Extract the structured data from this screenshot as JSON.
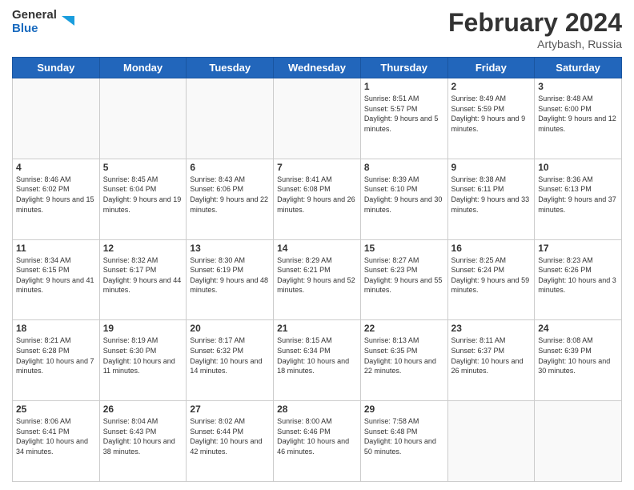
{
  "header": {
    "logo_line1": "General",
    "logo_line2": "Blue",
    "month_title": "February 2024",
    "subtitle": "Artybash, Russia"
  },
  "weekdays": [
    "Sunday",
    "Monday",
    "Tuesday",
    "Wednesday",
    "Thursday",
    "Friday",
    "Saturday"
  ],
  "weeks": [
    [
      {
        "day": "",
        "info": ""
      },
      {
        "day": "",
        "info": ""
      },
      {
        "day": "",
        "info": ""
      },
      {
        "day": "",
        "info": ""
      },
      {
        "day": "1",
        "info": "Sunrise: 8:51 AM\nSunset: 5:57 PM\nDaylight: 9 hours and 5 minutes."
      },
      {
        "day": "2",
        "info": "Sunrise: 8:49 AM\nSunset: 5:59 PM\nDaylight: 9 hours and 9 minutes."
      },
      {
        "day": "3",
        "info": "Sunrise: 8:48 AM\nSunset: 6:00 PM\nDaylight: 9 hours and 12 minutes."
      }
    ],
    [
      {
        "day": "4",
        "info": "Sunrise: 8:46 AM\nSunset: 6:02 PM\nDaylight: 9 hours and 15 minutes."
      },
      {
        "day": "5",
        "info": "Sunrise: 8:45 AM\nSunset: 6:04 PM\nDaylight: 9 hours and 19 minutes."
      },
      {
        "day": "6",
        "info": "Sunrise: 8:43 AM\nSunset: 6:06 PM\nDaylight: 9 hours and 22 minutes."
      },
      {
        "day": "7",
        "info": "Sunrise: 8:41 AM\nSunset: 6:08 PM\nDaylight: 9 hours and 26 minutes."
      },
      {
        "day": "8",
        "info": "Sunrise: 8:39 AM\nSunset: 6:10 PM\nDaylight: 9 hours and 30 minutes."
      },
      {
        "day": "9",
        "info": "Sunrise: 8:38 AM\nSunset: 6:11 PM\nDaylight: 9 hours and 33 minutes."
      },
      {
        "day": "10",
        "info": "Sunrise: 8:36 AM\nSunset: 6:13 PM\nDaylight: 9 hours and 37 minutes."
      }
    ],
    [
      {
        "day": "11",
        "info": "Sunrise: 8:34 AM\nSunset: 6:15 PM\nDaylight: 9 hours and 41 minutes."
      },
      {
        "day": "12",
        "info": "Sunrise: 8:32 AM\nSunset: 6:17 PM\nDaylight: 9 hours and 44 minutes."
      },
      {
        "day": "13",
        "info": "Sunrise: 8:30 AM\nSunset: 6:19 PM\nDaylight: 9 hours and 48 minutes."
      },
      {
        "day": "14",
        "info": "Sunrise: 8:29 AM\nSunset: 6:21 PM\nDaylight: 9 hours and 52 minutes."
      },
      {
        "day": "15",
        "info": "Sunrise: 8:27 AM\nSunset: 6:23 PM\nDaylight: 9 hours and 55 minutes."
      },
      {
        "day": "16",
        "info": "Sunrise: 8:25 AM\nSunset: 6:24 PM\nDaylight: 9 hours and 59 minutes."
      },
      {
        "day": "17",
        "info": "Sunrise: 8:23 AM\nSunset: 6:26 PM\nDaylight: 10 hours and 3 minutes."
      }
    ],
    [
      {
        "day": "18",
        "info": "Sunrise: 8:21 AM\nSunset: 6:28 PM\nDaylight: 10 hours and 7 minutes."
      },
      {
        "day": "19",
        "info": "Sunrise: 8:19 AM\nSunset: 6:30 PM\nDaylight: 10 hours and 11 minutes."
      },
      {
        "day": "20",
        "info": "Sunrise: 8:17 AM\nSunset: 6:32 PM\nDaylight: 10 hours and 14 minutes."
      },
      {
        "day": "21",
        "info": "Sunrise: 8:15 AM\nSunset: 6:34 PM\nDaylight: 10 hours and 18 minutes."
      },
      {
        "day": "22",
        "info": "Sunrise: 8:13 AM\nSunset: 6:35 PM\nDaylight: 10 hours and 22 minutes."
      },
      {
        "day": "23",
        "info": "Sunrise: 8:11 AM\nSunset: 6:37 PM\nDaylight: 10 hours and 26 minutes."
      },
      {
        "day": "24",
        "info": "Sunrise: 8:08 AM\nSunset: 6:39 PM\nDaylight: 10 hours and 30 minutes."
      }
    ],
    [
      {
        "day": "25",
        "info": "Sunrise: 8:06 AM\nSunset: 6:41 PM\nDaylight: 10 hours and 34 minutes."
      },
      {
        "day": "26",
        "info": "Sunrise: 8:04 AM\nSunset: 6:43 PM\nDaylight: 10 hours and 38 minutes."
      },
      {
        "day": "27",
        "info": "Sunrise: 8:02 AM\nSunset: 6:44 PM\nDaylight: 10 hours and 42 minutes."
      },
      {
        "day": "28",
        "info": "Sunrise: 8:00 AM\nSunset: 6:46 PM\nDaylight: 10 hours and 46 minutes."
      },
      {
        "day": "29",
        "info": "Sunrise: 7:58 AM\nSunset: 6:48 PM\nDaylight: 10 hours and 50 minutes."
      },
      {
        "day": "",
        "info": ""
      },
      {
        "day": "",
        "info": ""
      }
    ]
  ]
}
